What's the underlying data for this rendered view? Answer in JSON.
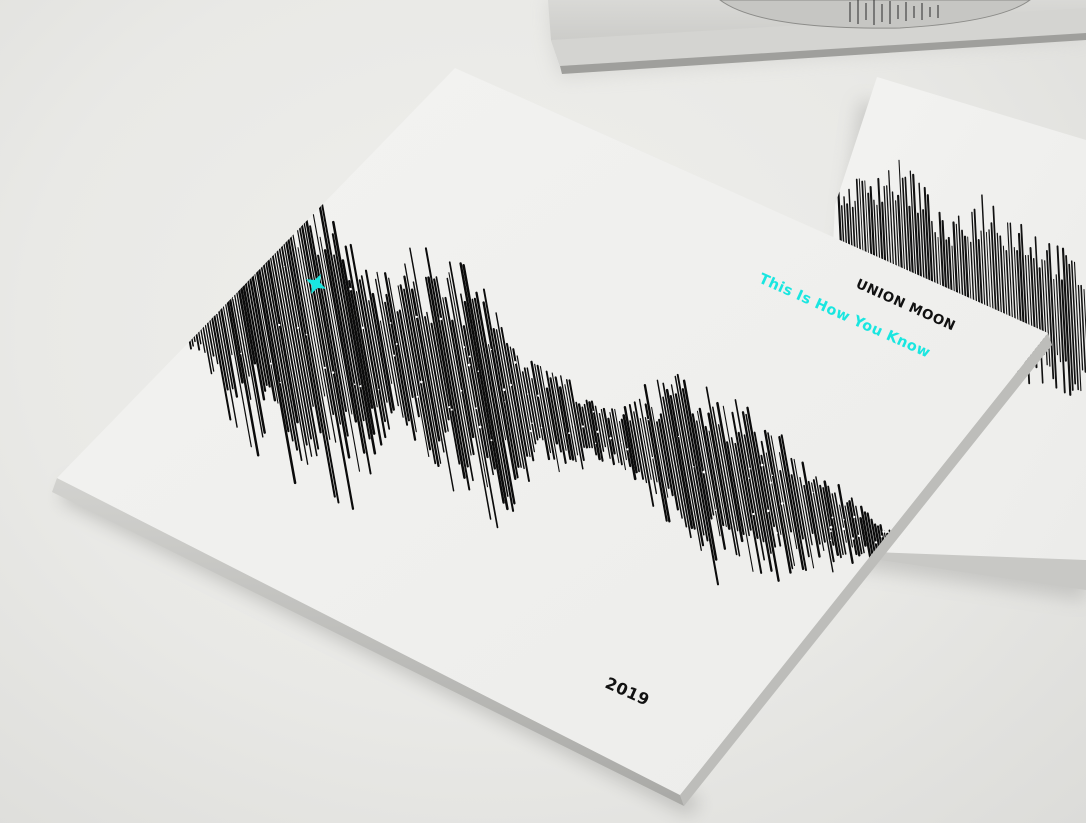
{
  "album": {
    "artist": "UNION MOON",
    "title": "This Is How You Know",
    "year": "2019"
  },
  "colors": {
    "background": "#e9e9e6",
    "cover": "#f1f1ef",
    "waveform": "#0b0b0b",
    "accent": "#19e6e0",
    "text": "#111111"
  },
  "icons": {
    "star": "four-point-star-icon"
  }
}
